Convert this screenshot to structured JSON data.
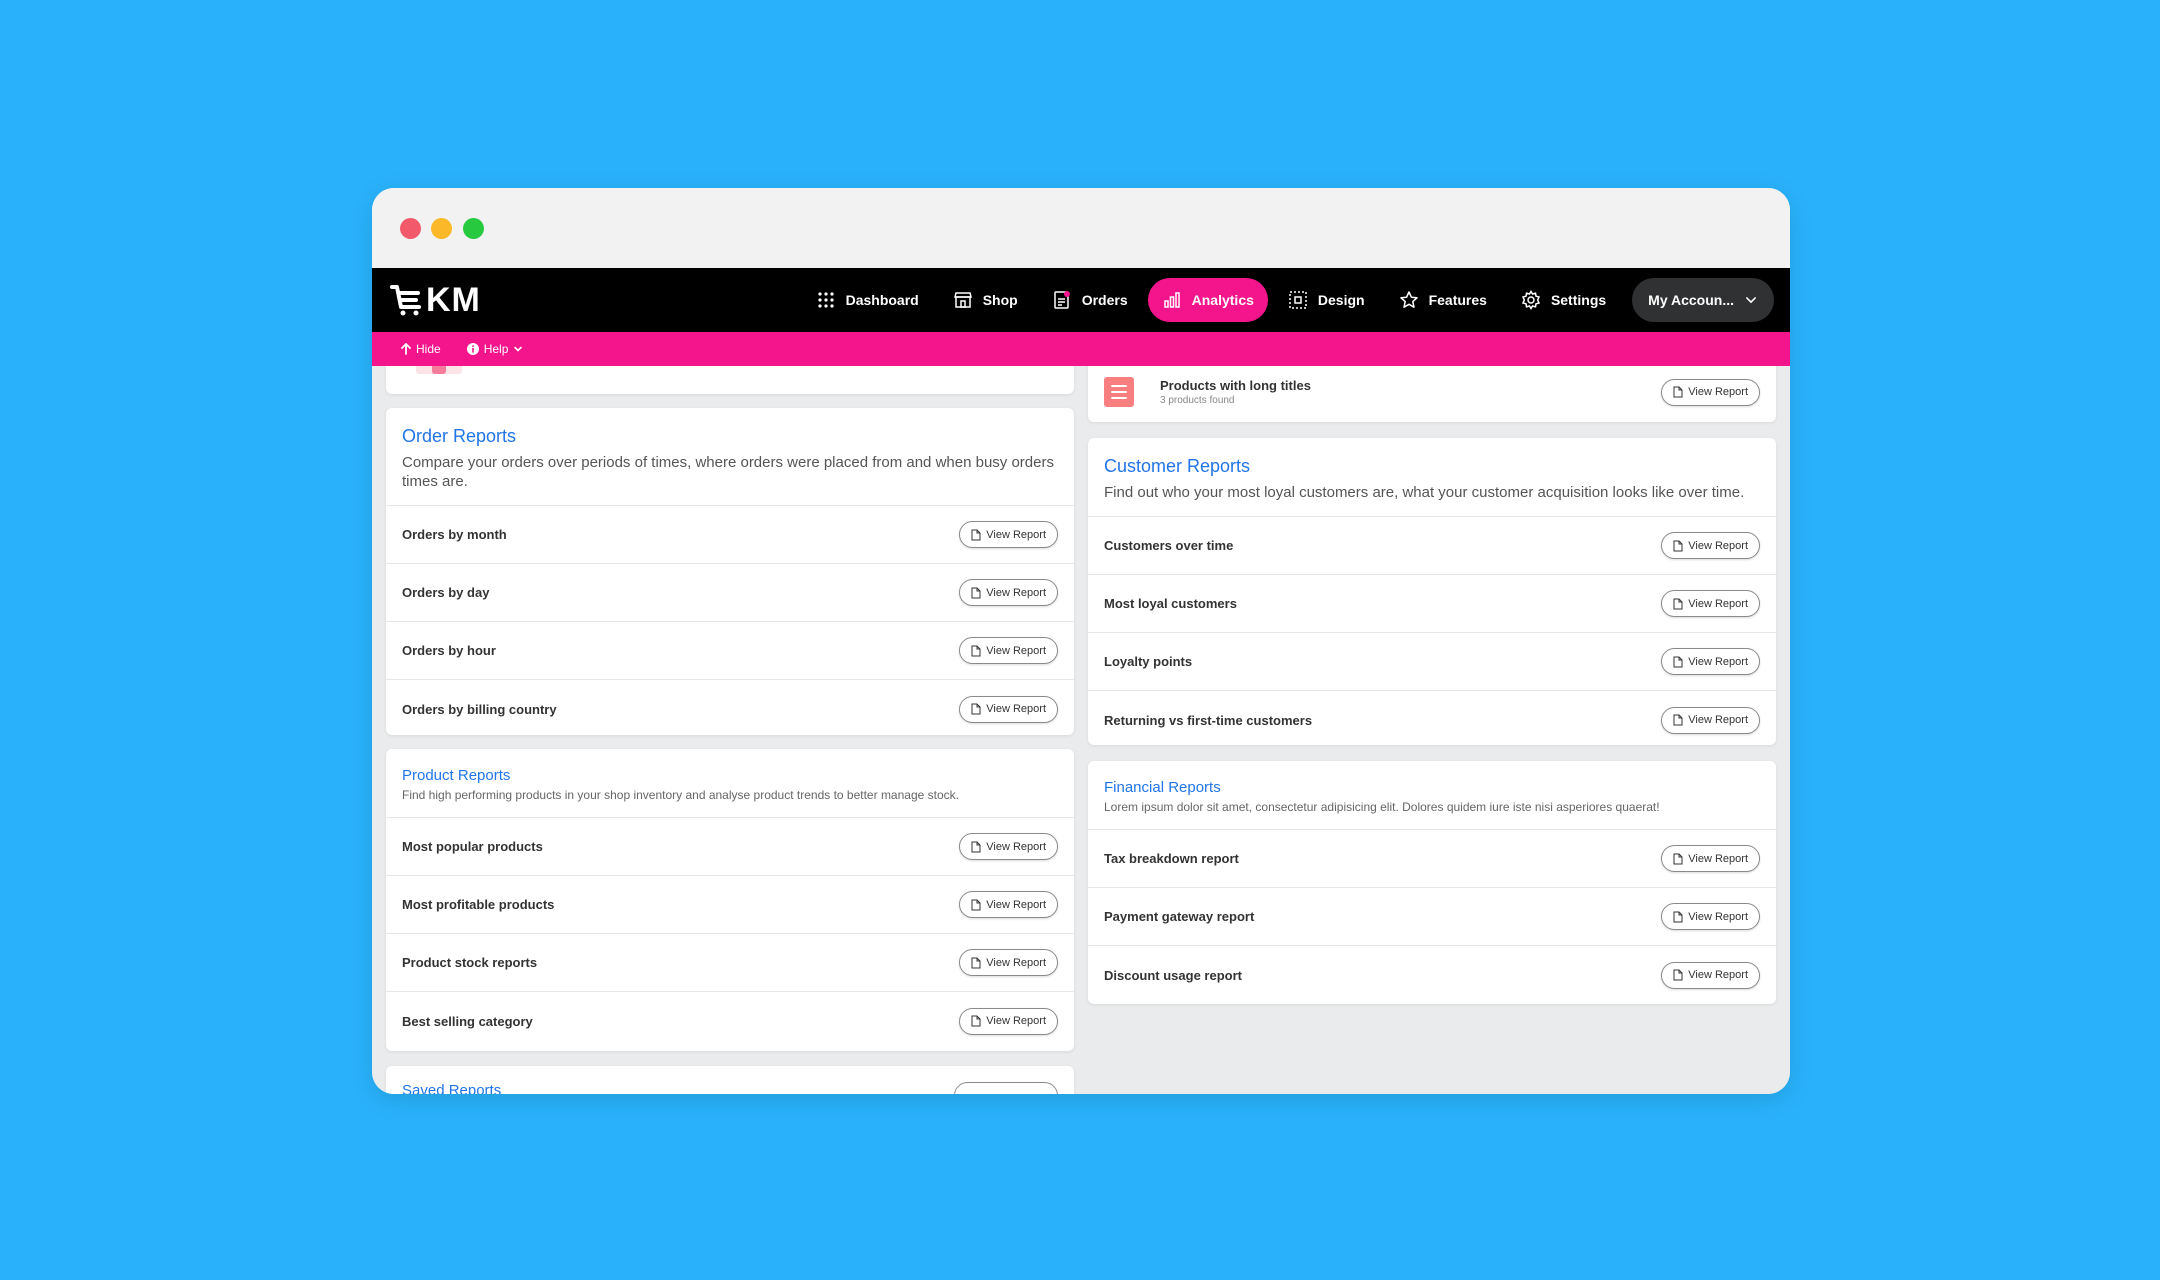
{
  "nav": {
    "logo_text": "KM",
    "items": [
      {
        "label": "Dashboard",
        "icon": "grid-icon"
      },
      {
        "label": "Shop",
        "icon": "shop-icon"
      },
      {
        "label": "Orders",
        "icon": "orders-icon"
      },
      {
        "label": "Analytics",
        "icon": "chart-icon"
      },
      {
        "label": "Design",
        "icon": "design-icon"
      },
      {
        "label": "Features",
        "icon": "star-icon"
      },
      {
        "label": "Settings",
        "icon": "gear-icon"
      }
    ],
    "account_label": "My Accoun..."
  },
  "subbar": {
    "hide_label": "Hide",
    "help_label": "Help"
  },
  "accent_color": "#f4148c",
  "link_color": "#2175e6",
  "view_report_label": "View Report",
  "top_right": {
    "label": "Products with long titles",
    "sub": "3 products found"
  },
  "order_reports": {
    "title": "Order Reports",
    "desc": "Compare your orders over periods of times, where orders were placed from and when busy orders times are.",
    "rows": [
      "Orders by month",
      "Orders by day",
      "Orders by hour",
      "Orders by billing country"
    ]
  },
  "product_reports": {
    "title": "Product Reports",
    "desc": "Find high performing products in your shop inventory and analyse product trends to better manage stock.",
    "rows": [
      "Most popular products",
      "Most profitable products",
      "Product stock reports",
      "Best selling category"
    ]
  },
  "saved_reports": {
    "title": "Saved Reports"
  },
  "customer_reports": {
    "title": "Customer Reports",
    "desc": "Find out who your most loyal customers are, what your customer acquisition looks like over time.",
    "rows": [
      "Customers over time",
      "Most loyal customers",
      "Loyalty points",
      "Returning vs first-time customers"
    ]
  },
  "financial_reports": {
    "title": "Financial Reports",
    "desc": "Lorem ipsum dolor sit amet, consectetur adipisicing elit. Dolores quidem iure iste nisi asperiores quaerat!",
    "rows": [
      "Tax breakdown report",
      "Payment gateway report",
      "Discount usage report"
    ]
  }
}
